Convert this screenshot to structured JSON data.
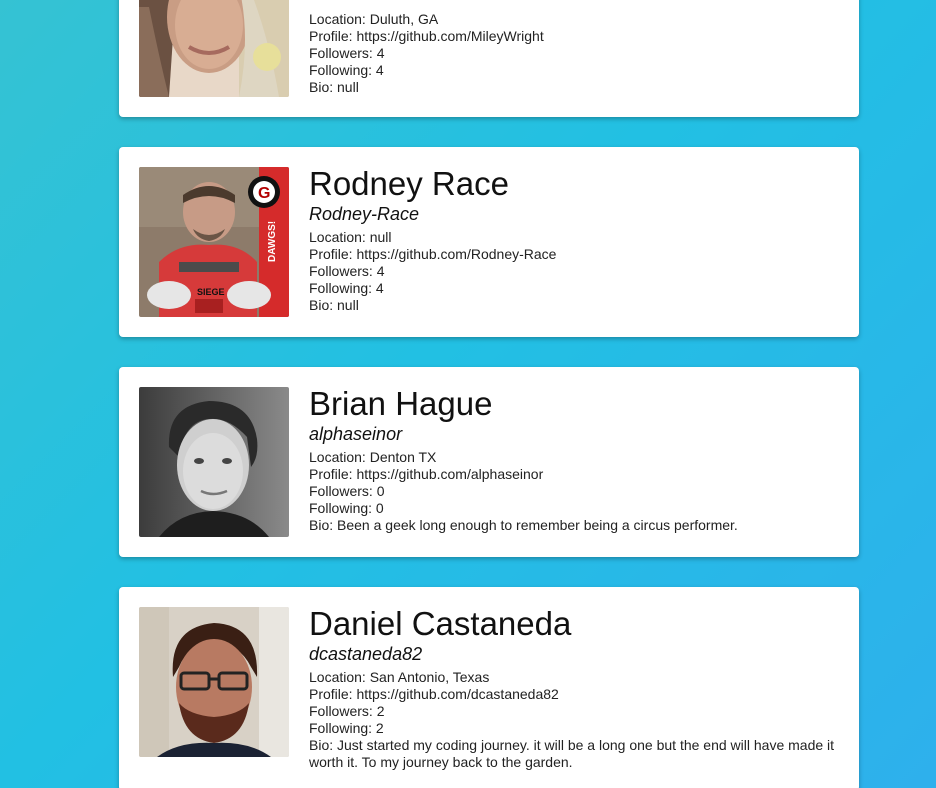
{
  "cards": [
    {
      "name": "",
      "username": "",
      "location_label": "Location:",
      "location": "Duluth, GA",
      "profile_label": "Profile:",
      "profile": "https://github.com/MileyWright",
      "followers_label": "Followers:",
      "followers": "4",
      "following_label": "Following:",
      "following": "4",
      "bio_label": "Bio:",
      "bio": "null"
    },
    {
      "name": "Rodney Race",
      "username": "Rodney-Race",
      "location_label": "Location:",
      "location": "null",
      "profile_label": "Profile:",
      "profile": "https://github.com/Rodney-Race",
      "followers_label": "Followers:",
      "followers": "4",
      "following_label": "Following:",
      "following": "4",
      "bio_label": "Bio:",
      "bio": "null"
    },
    {
      "name": "Brian Hague",
      "username": "alphaseinor",
      "location_label": "Location:",
      "location": "Denton TX",
      "profile_label": "Profile:",
      "profile": "https://github.com/alphaseinor",
      "followers_label": "Followers:",
      "followers": "0",
      "following_label": "Following:",
      "following": "0",
      "bio_label": "Bio:",
      "bio": "Been a geek long enough to remember being a circus performer."
    },
    {
      "name": "Daniel Castaneda",
      "username": "dcastaneda82",
      "location_label": "Location:",
      "location": "San Antonio, Texas",
      "profile_label": "Profile:",
      "profile": "https://github.com/dcastaneda82",
      "followers_label": "Followers:",
      "followers": "2",
      "following_label": "Following:",
      "following": "2",
      "bio_label": "Bio:",
      "bio": "Just started my coding journey. it will be a long one but the end will have made it worth it. To my journey back to the garden."
    }
  ],
  "avatar_badge_text": "DAWGS!",
  "avatar_shirt_text": "SIEGE"
}
